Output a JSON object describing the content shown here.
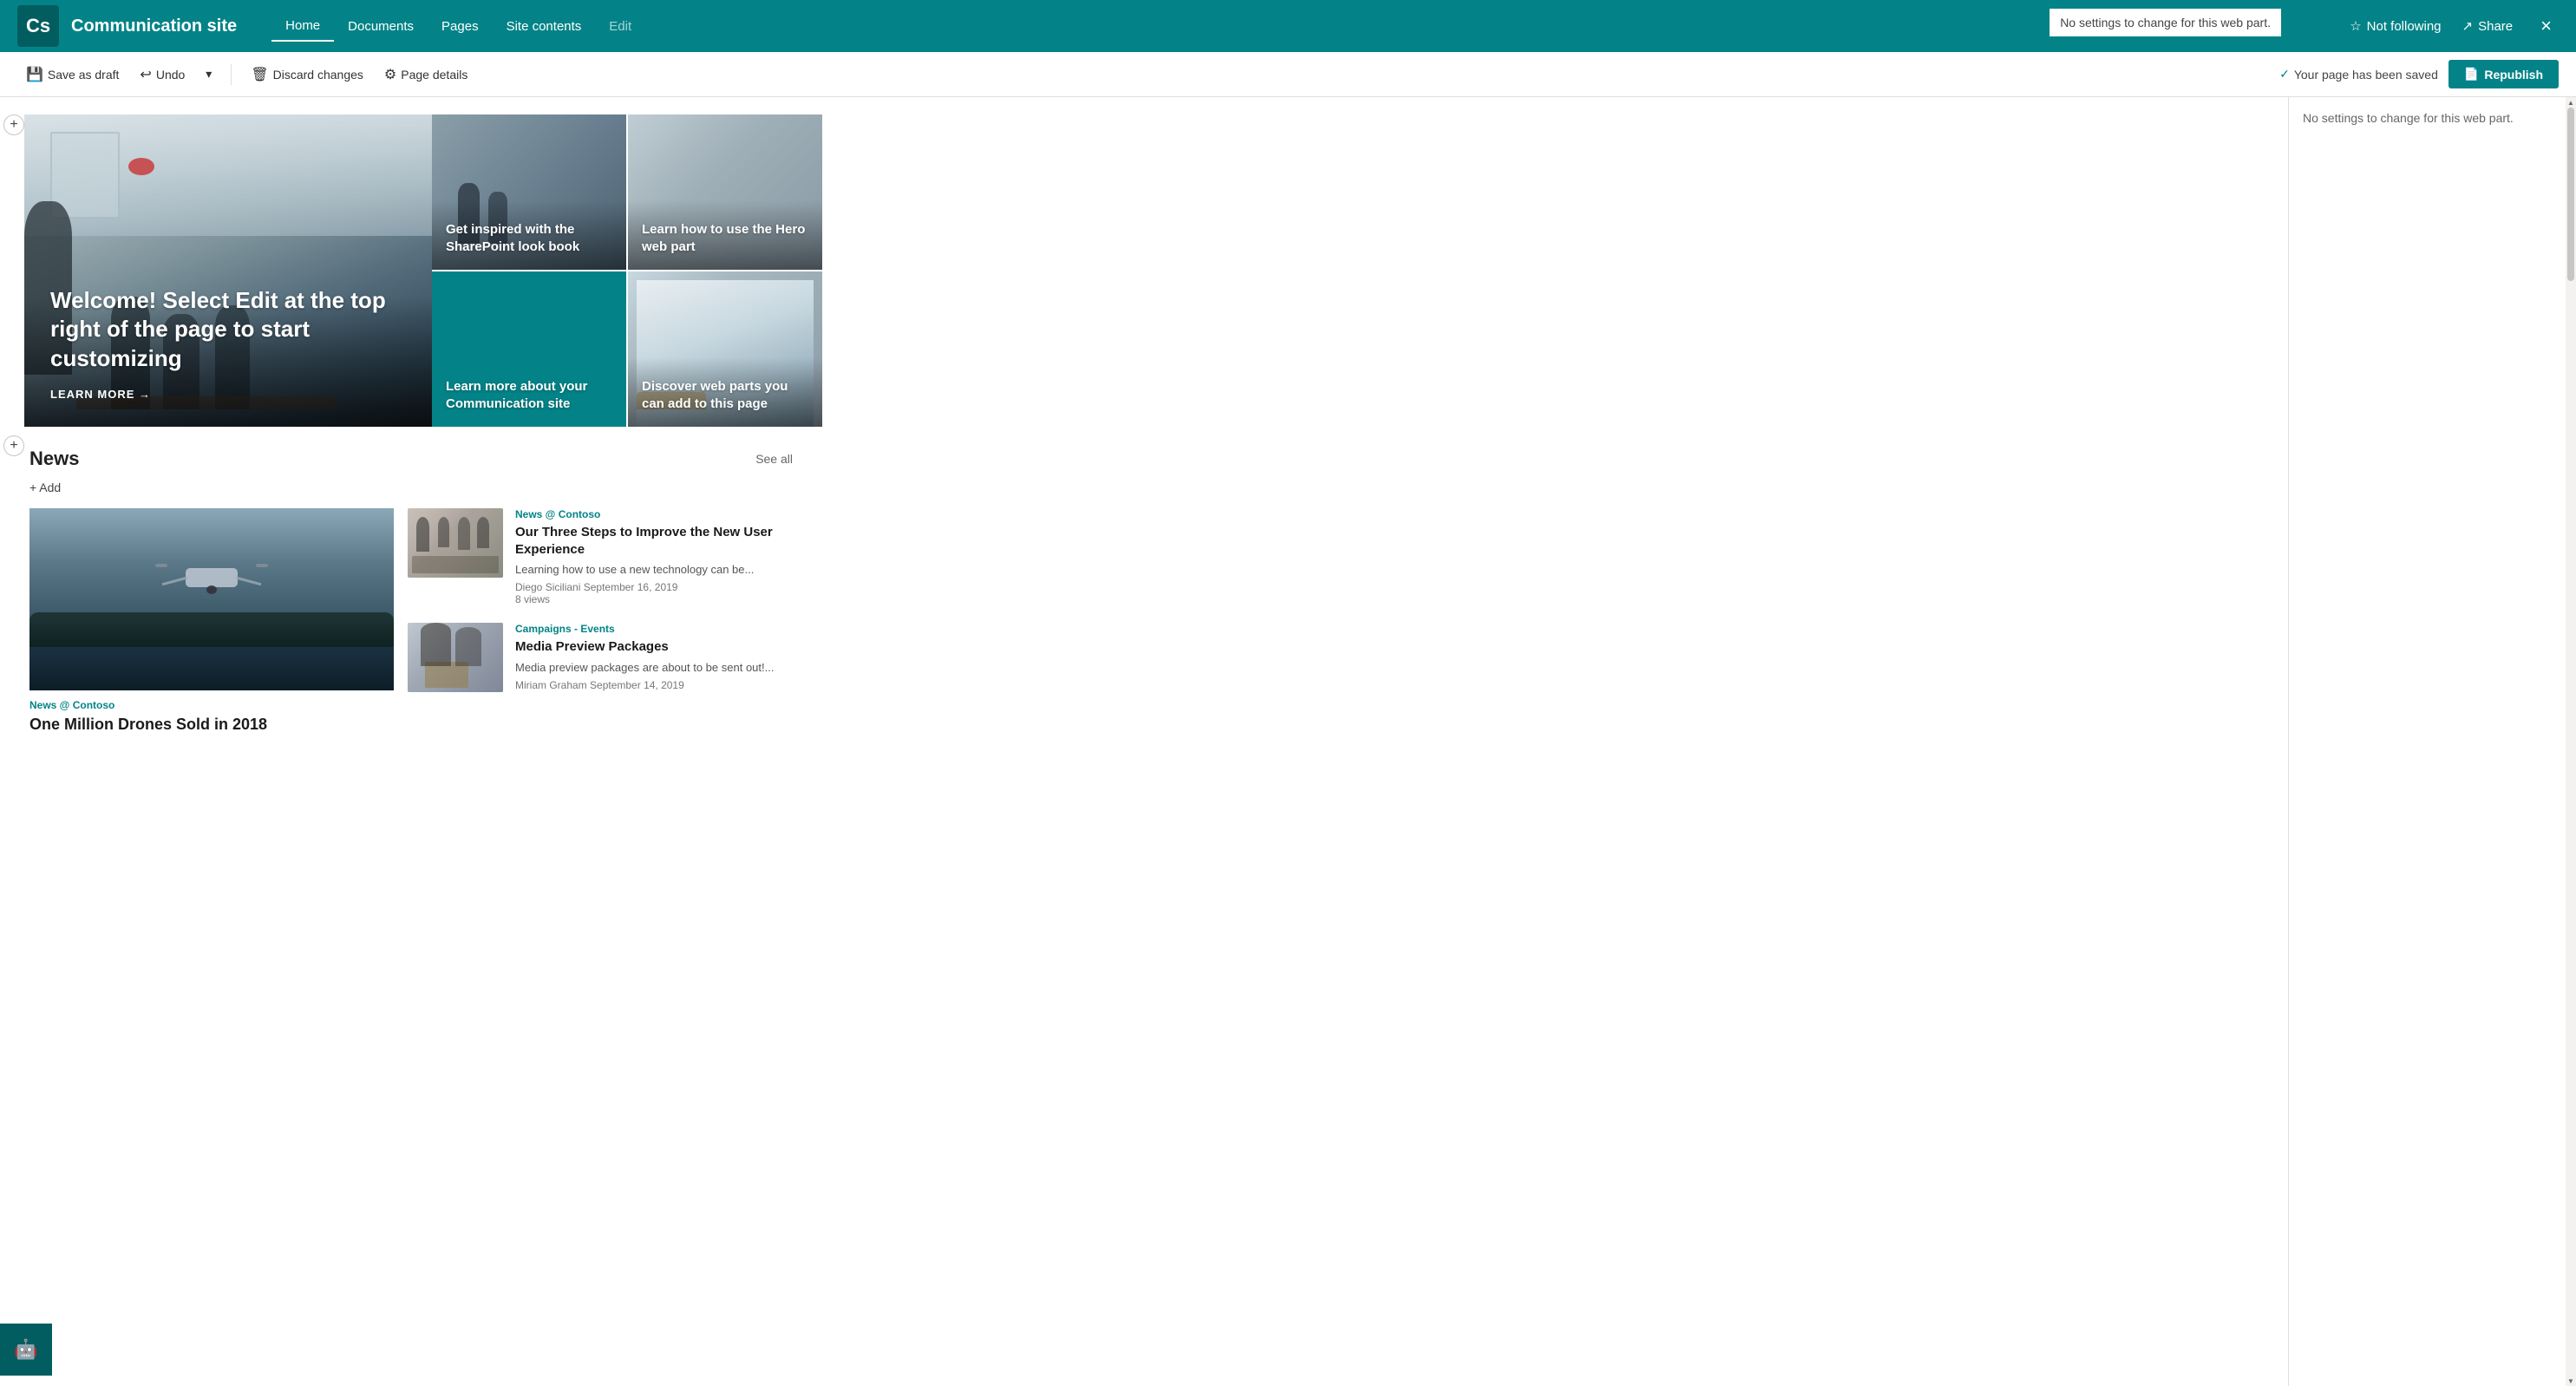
{
  "app": {
    "logo_initials": "Cs",
    "site_title": "Communication site"
  },
  "nav": {
    "links": [
      {
        "label": "Home",
        "active": true
      },
      {
        "label": "Documents",
        "active": false
      },
      {
        "label": "Pages",
        "active": false
      },
      {
        "label": "Site contents",
        "active": false
      },
      {
        "label": "Edit",
        "active": false,
        "accent": true
      }
    ]
  },
  "topbar_actions": {
    "not_following_label": "Not following",
    "share_label": "Share",
    "close_label": "×"
  },
  "right_panel": {
    "no_settings_text": "No settings to change for this web part."
  },
  "edit_toolbar": {
    "save_draft_label": "Save as draft",
    "undo_label": "Undo",
    "discard_label": "Discard changes",
    "page_details_label": "Page details",
    "saved_status": "Your page has been saved",
    "republish_label": "Republish"
  },
  "hero": {
    "main_title": "Welcome! Select Edit at the top right of the page to start customizing",
    "learn_more_label": "LEARN MORE →",
    "tile1_label": "Get inspired with the SharePoint look book",
    "tile2_label": "Learn how to use the Hero web part",
    "tile3_label": "Learn more about your Communication site",
    "tile4_label": "Discover web parts you can add to this page"
  },
  "news": {
    "section_title": "News",
    "see_all_label": "See all",
    "add_label": "+ Add",
    "featured": {
      "category": "News @ Contoso",
      "title": "One Million Drones Sold in 2018"
    },
    "items": [
      {
        "category": "News @ Contoso",
        "title": "Our Three Steps to Improve the New User Experience",
        "description": "Learning how to use a new technology can be...",
        "author": "Diego Siciliani",
        "date": "September 16, 2019",
        "views": "8 views"
      },
      {
        "category": "Campaigns - Events",
        "title": "Media Preview Packages",
        "description": "Media preview packages are about to be sent out!...",
        "author": "Miriam Graham",
        "date": "September 14, 2019",
        "views": ""
      }
    ]
  },
  "colors": {
    "teal": "#038387",
    "dark_teal": "#025d60"
  }
}
